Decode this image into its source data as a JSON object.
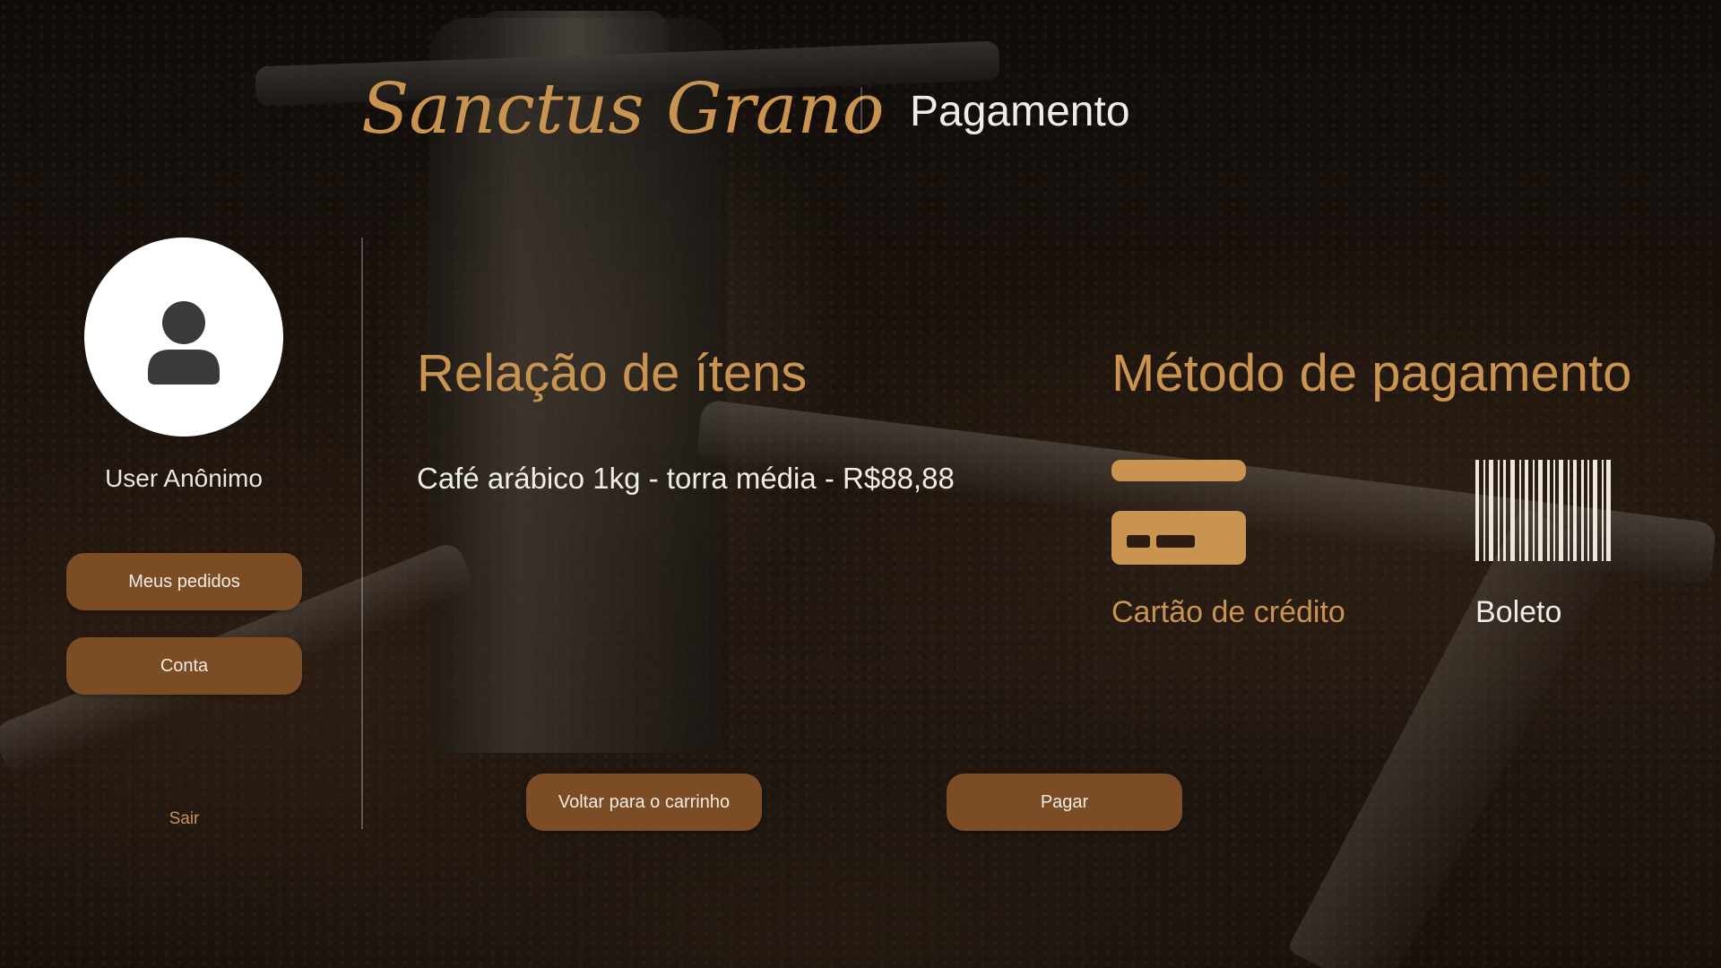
{
  "header": {
    "brand": "Sanctus Grano",
    "page_title": "Pagamento"
  },
  "sidebar": {
    "avatar_icon": "user-icon",
    "user_name": "User Anônimo",
    "buttons": [
      {
        "label": "Meus pedidos"
      },
      {
        "label": "Conta"
      }
    ],
    "logout_label": "Sair"
  },
  "items": {
    "title": "Relação de ítens",
    "list": [
      "Café arábico 1kg - torra média - R$88,88"
    ]
  },
  "payment": {
    "title": "Método de pagamento",
    "methods": [
      {
        "label": "Cartão de crédito",
        "icon": "credit-card-icon",
        "selected": true
      },
      {
        "label": "Boleto",
        "icon": "barcode-icon",
        "selected": false
      }
    ]
  },
  "actions": {
    "back_label": "Voltar para o carrinho",
    "pay_label": "Pagar"
  },
  "colors": {
    "accent": "#c89450",
    "button": "#7c4c24",
    "text": "#f1ece6"
  }
}
